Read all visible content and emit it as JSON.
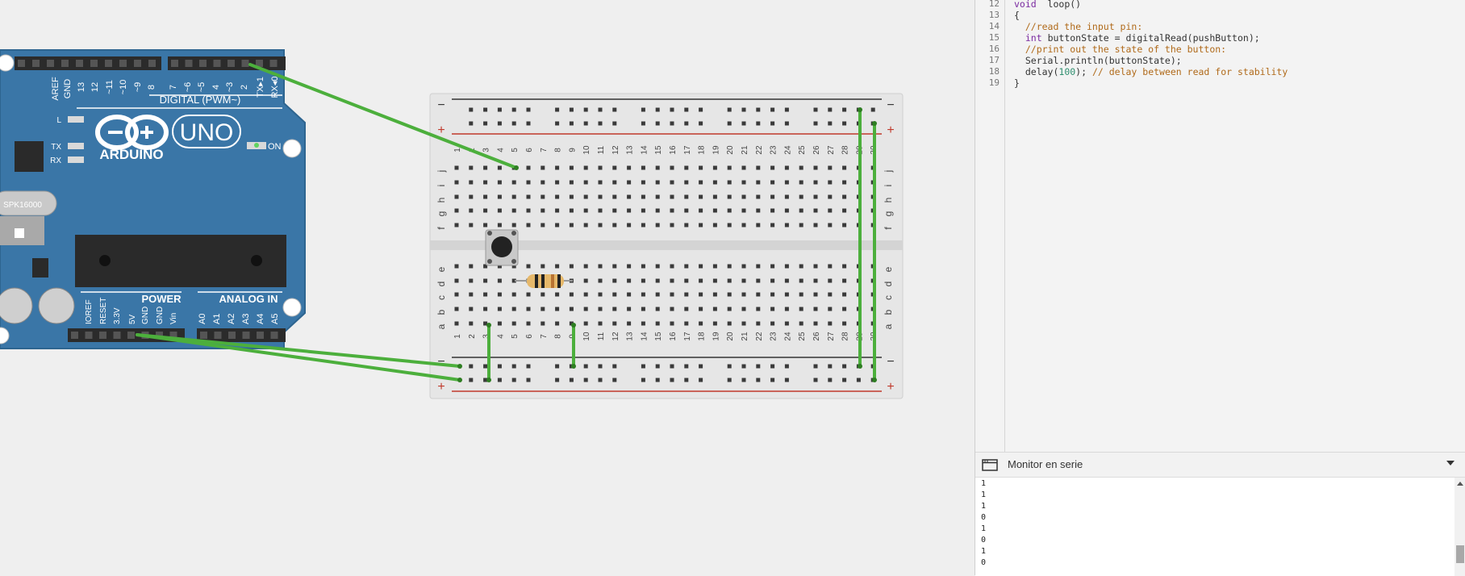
{
  "board": {
    "aref": "AREF",
    "gnd": "GND",
    "digital_pins": [
      "13",
      "12",
      "~11",
      "~10",
      "~9",
      "8",
      "7",
      "~6",
      "~5",
      "4",
      "~3",
      "2",
      "TX▸1",
      "RX◂0"
    ],
    "digital_label": "DIGITAL (PWM~)",
    "led_l": "L",
    "led_tx": "TX",
    "led_rx": "RX",
    "brand": "ARDUINO",
    "model": "UNO",
    "on_label": "ON",
    "crystal": "SPK16000",
    "power_pins": [
      "IOREF",
      "RESET",
      "3.3V",
      "5V",
      "GND",
      "GND",
      "Vin"
    ],
    "power_label": "POWER",
    "analog_pins": [
      "A0",
      "A1",
      "A2",
      "A3",
      "A4",
      "A5"
    ],
    "analog_label": "ANALOG IN"
  },
  "breadboard": {
    "minus": "−",
    "plus": "+",
    "top_rows": [
      "j",
      "i",
      "h",
      "g",
      "f"
    ],
    "bottom_rows": [
      "e",
      "d",
      "c",
      "b",
      "a"
    ],
    "columns": 30
  },
  "code": {
    "lines": [
      {
        "n": "12",
        "parts": [
          [
            "kw",
            "void"
          ],
          [
            "",
            "  loop()"
          ]
        ]
      },
      {
        "n": "13",
        "parts": [
          [
            "",
            "{"
          ]
        ]
      },
      {
        "n": "14",
        "parts": [
          [
            "cm",
            "  //read the input pin:"
          ]
        ]
      },
      {
        "n": "15",
        "parts": [
          [
            "",
            "  "
          ],
          [
            "kw",
            "int"
          ],
          [
            "",
            " buttonState = digitalRead(pushButton);"
          ]
        ]
      },
      {
        "n": "16",
        "parts": [
          [
            "cm",
            "  //print out the state of the button:"
          ]
        ]
      },
      {
        "n": "17",
        "parts": [
          [
            "",
            "  Serial.println(buttonState);"
          ]
        ]
      },
      {
        "n": "18",
        "parts": [
          [
            "",
            "  delay("
          ],
          [
            "num",
            "100"
          ],
          [
            "",
            "); "
          ],
          [
            "cm",
            "// delay between read for stability"
          ]
        ]
      },
      {
        "n": "19",
        "parts": [
          [
            "",
            "}"
          ]
        ]
      }
    ]
  },
  "monitor": {
    "title": "Monitor en serie",
    "output": [
      "1",
      "1",
      "1",
      "0",
      "1",
      "0",
      "1",
      "0"
    ]
  }
}
